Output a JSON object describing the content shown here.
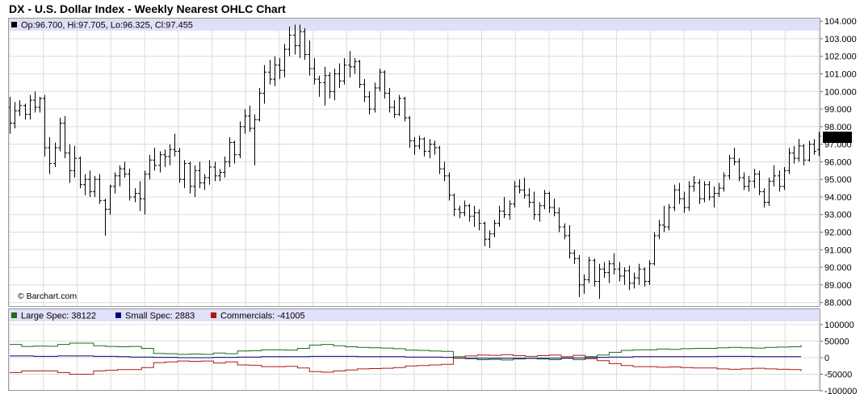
{
  "title": "DX - U.S. Dollar Index - Weekly Nearest OHLC Chart",
  "credit": "© Barchart.com",
  "colors": {
    "grid": "#dcdcdc",
    "legend_band": "#e0e0f8",
    "bar": "#000000",
    "large_spec": "#1a6b1a",
    "small_spec": "#000080",
    "commercials": "#b01818",
    "last_box_bg": "#000000",
    "last_box_fg": "#ffffff"
  },
  "chart_data": [
    {
      "type": "ohlc",
      "name": "price",
      "legend": {
        "open_label": "Op:",
        "open": "96.700",
        "high_label": "Hi:",
        "high": "97.705",
        "low_label": "Lo:",
        "low": "96.325",
        "close_label": "Cl:",
        "close": "97.455"
      },
      "last_value_label": "97.455",
      "ylim": [
        87.8,
        104.1
      ],
      "yticks": [
        "88.000",
        "89.000",
        "90.000",
        "91.000",
        "92.000",
        "93.000",
        "94.000",
        "95.000",
        "96.000",
        "97.000",
        "98.000",
        "99.000",
        "100.000",
        "101.000",
        "102.000",
        "103.000",
        "104.000"
      ],
      "bars": [
        [
          99.1,
          99.7,
          97.6,
          98.2
        ],
        [
          98.2,
          99.4,
          97.9,
          98.9
        ],
        [
          98.9,
          99.5,
          98.6,
          99.2
        ],
        [
          99.2,
          99.3,
          98.4,
          98.7
        ],
        [
          98.7,
          99.8,
          98.4,
          99.5
        ],
        [
          99.5,
          100.0,
          98.8,
          99.1
        ],
        [
          99.1,
          99.7,
          98.8,
          99.6
        ],
        [
          99.6,
          99.8,
          96.3,
          96.8
        ],
        [
          96.8,
          97.4,
          95.3,
          95.9
        ],
        [
          95.9,
          97.1,
          95.7,
          96.8
        ],
        [
          96.8,
          98.5,
          96.6,
          98.2
        ],
        [
          98.2,
          98.6,
          96.2,
          96.5
        ],
        [
          96.5,
          97.0,
          94.8,
          95.5
        ],
        [
          95.5,
          96.9,
          95.1,
          96.2
        ],
        [
          96.2,
          96.3,
          94.5,
          94.7
        ],
        [
          94.7,
          95.3,
          94.1,
          95.0
        ],
        [
          95.0,
          95.5,
          94.0,
          94.3
        ],
        [
          94.3,
          95.2,
          94.0,
          95.0
        ],
        [
          95.0,
          95.3,
          93.6,
          93.8
        ],
        [
          93.8,
          93.9,
          91.8,
          93.3
        ],
        [
          93.3,
          94.7,
          93.0,
          94.6
        ],
        [
          94.6,
          95.4,
          94.2,
          95.2
        ],
        [
          95.2,
          95.8,
          94.6,
          95.6
        ],
        [
          95.6,
          96.0,
          95.1,
          95.3
        ],
        [
          95.3,
          95.6,
          93.8,
          94.0
        ],
        [
          94.0,
          94.5,
          93.7,
          94.2
        ],
        [
          94.2,
          94.9,
          93.2,
          93.9
        ],
        [
          93.9,
          95.5,
          93.0,
          95.3
        ],
        [
          95.3,
          96.4,
          95.0,
          96.1
        ],
        [
          96.1,
          96.8,
          95.5,
          95.8
        ],
        [
          95.8,
          96.6,
          95.4,
          96.4
        ],
        [
          96.4,
          96.7,
          95.7,
          96.3
        ],
        [
          96.3,
          97.0,
          95.8,
          96.7
        ],
        [
          96.7,
          97.6,
          96.3,
          96.6
        ],
        [
          96.6,
          96.8,
          94.8,
          95.0
        ],
        [
          95.0,
          96.1,
          94.5,
          95.9
        ],
        [
          95.9,
          96.0,
          94.2,
          94.6
        ],
        [
          94.6,
          95.8,
          94.0,
          95.5
        ],
        [
          95.5,
          96.0,
          94.5,
          94.8
        ],
        [
          94.8,
          95.3,
          94.4,
          95.1
        ],
        [
          95.1,
          96.1,
          94.7,
          95.7
        ],
        [
          95.7,
          96.0,
          94.9,
          95.2
        ],
        [
          95.2,
          95.6,
          94.9,
          95.4
        ],
        [
          95.4,
          96.3,
          95.1,
          96.0
        ],
        [
          96.0,
          97.4,
          95.7,
          97.1
        ],
        [
          97.1,
          97.2,
          95.9,
          96.4
        ],
        [
          96.4,
          98.3,
          96.2,
          98.0
        ],
        [
          98.0,
          99.0,
          97.6,
          98.6
        ],
        [
          98.6,
          99.2,
          97.7,
          97.9
        ],
        [
          97.9,
          98.7,
          95.8,
          98.4
        ],
        [
          98.4,
          100.2,
          98.3,
          99.9
        ],
        [
          99.9,
          101.5,
          99.3,
          101.1
        ],
        [
          101.1,
          101.8,
          100.4,
          100.7
        ],
        [
          100.7,
          102.0,
          100.3,
          101.5
        ],
        [
          101.5,
          101.9,
          100.7,
          101.2
        ],
        [
          101.2,
          102.7,
          100.8,
          102.4
        ],
        [
          102.4,
          103.7,
          102.0,
          103.2
        ],
        [
          103.2,
          103.8,
          102.1,
          102.6
        ],
        [
          102.6,
          103.8,
          101.9,
          103.4
        ],
        [
          103.4,
          103.6,
          101.8,
          102.1
        ],
        [
          102.1,
          102.9,
          100.9,
          101.3
        ],
        [
          101.3,
          101.9,
          100.4,
          100.7
        ],
        [
          100.7,
          100.9,
          99.7,
          100.5
        ],
        [
          100.5,
          101.4,
          99.2,
          100.9
        ],
        [
          100.9,
          101.1,
          99.6,
          100.0
        ],
        [
          100.0,
          101.3,
          99.5,
          101.0
        ],
        [
          101.0,
          101.6,
          100.2,
          100.6
        ],
        [
          100.6,
          101.9,
          100.4,
          101.5
        ],
        [
          101.5,
          102.3,
          100.8,
          101.4
        ],
        [
          101.4,
          101.9,
          101.0,
          101.7
        ],
        [
          101.7,
          101.8,
          100.2,
          100.4
        ],
        [
          100.4,
          100.7,
          99.4,
          99.7
        ],
        [
          99.7,
          100.0,
          98.7,
          99.0
        ],
        [
          99.0,
          100.5,
          98.8,
          100.2
        ],
        [
          100.2,
          101.3,
          100.0,
          101.1
        ],
        [
          101.1,
          101.2,
          99.6,
          99.9
        ],
        [
          99.9,
          100.2,
          98.8,
          99.1
        ],
        [
          99.1,
          99.5,
          98.5,
          98.7
        ],
        [
          98.7,
          99.8,
          98.6,
          99.6
        ],
        [
          99.6,
          99.7,
          98.3,
          98.5
        ],
        [
          98.5,
          98.6,
          96.8,
          97.2
        ],
        [
          97.2,
          97.4,
          96.4,
          96.9
        ],
        [
          96.9,
          97.5,
          96.7,
          97.3
        ],
        [
          97.3,
          97.4,
          96.3,
          96.6
        ],
        [
          96.6,
          97.3,
          96.2,
          97.0
        ],
        [
          97.0,
          97.2,
          96.4,
          96.8
        ],
        [
          96.8,
          96.9,
          95.3,
          95.6
        ],
        [
          95.6,
          96.0,
          94.9,
          95.2
        ],
        [
          95.2,
          95.4,
          93.8,
          94.1
        ],
        [
          94.1,
          94.2,
          92.9,
          93.3
        ],
        [
          93.3,
          93.5,
          92.8,
          93.1
        ],
        [
          93.1,
          93.8,
          92.9,
          93.5
        ],
        [
          93.5,
          93.6,
          92.6,
          92.9
        ],
        [
          92.9,
          93.5,
          92.3,
          93.1
        ],
        [
          93.1,
          93.3,
          92.1,
          92.5
        ],
        [
          92.5,
          92.6,
          91.2,
          91.6
        ],
        [
          91.6,
          92.1,
          91.1,
          91.9
        ],
        [
          91.9,
          92.7,
          91.7,
          92.5
        ],
        [
          92.5,
          93.5,
          92.3,
          93.2
        ],
        [
          93.2,
          94.0,
          92.8,
          93.0
        ],
        [
          93.0,
          93.8,
          92.7,
          93.6
        ],
        [
          93.6,
          94.9,
          93.4,
          94.6
        ],
        [
          94.6,
          95.0,
          94.2,
          94.4
        ],
        [
          94.4,
          95.1,
          93.9,
          94.1
        ],
        [
          94.1,
          94.5,
          93.4,
          93.7
        ],
        [
          93.7,
          94.3,
          92.7,
          93.0
        ],
        [
          93.0,
          93.7,
          92.6,
          93.5
        ],
        [
          93.5,
          94.4,
          93.3,
          94.2
        ],
        [
          94.2,
          94.3,
          93.1,
          93.4
        ],
        [
          93.4,
          93.9,
          92.9,
          93.1
        ],
        [
          93.1,
          93.4,
          92.0,
          92.3
        ],
        [
          92.3,
          92.5,
          91.6,
          91.8
        ],
        [
          91.8,
          92.4,
          90.5,
          90.8
        ],
        [
          90.8,
          91.0,
          90.2,
          90.5
        ],
        [
          90.5,
          90.7,
          88.3,
          89.0
        ],
        [
          89.0,
          89.6,
          88.5,
          89.3
        ],
        [
          89.3,
          90.6,
          89.1,
          90.4
        ],
        [
          90.4,
          90.5,
          88.9,
          89.2
        ],
        [
          89.2,
          90.2,
          88.2,
          89.9
        ],
        [
          89.9,
          90.3,
          89.4,
          89.7
        ],
        [
          89.7,
          90.4,
          89.1,
          90.2
        ],
        [
          90.2,
          90.8,
          89.6,
          89.9
        ],
        [
          89.9,
          90.3,
          89.2,
          89.5
        ],
        [
          89.5,
          90.0,
          89.0,
          89.8
        ],
        [
          89.8,
          90.1,
          88.7,
          89.1
        ],
        [
          89.1,
          89.7,
          88.8,
          89.4
        ],
        [
          89.4,
          90.2,
          89.0,
          89.9
        ],
        [
          89.9,
          90.0,
          88.9,
          89.2
        ],
        [
          89.2,
          90.4,
          89.0,
          90.2
        ],
        [
          90.2,
          92.0,
          90.1,
          91.8
        ],
        [
          91.8,
          92.7,
          91.6,
          92.4
        ],
        [
          92.4,
          93.5,
          92.0,
          92.3
        ],
        [
          92.3,
          93.6,
          92.1,
          93.4
        ],
        [
          93.4,
          94.7,
          93.2,
          94.4
        ],
        [
          94.4,
          94.8,
          93.6,
          93.9
        ],
        [
          93.9,
          94.3,
          93.1,
          93.4
        ],
        [
          93.4,
          94.9,
          93.2,
          94.6
        ],
        [
          94.6,
          95.2,
          94.3,
          94.8
        ],
        [
          94.8,
          95.0,
          93.6,
          93.9
        ],
        [
          93.9,
          94.9,
          93.7,
          94.7
        ],
        [
          94.7,
          94.9,
          93.8,
          94.0
        ],
        [
          94.0,
          94.6,
          93.4,
          94.2
        ],
        [
          94.2,
          94.8,
          94.0,
          94.5
        ],
        [
          94.5,
          95.4,
          94.3,
          95.2
        ],
        [
          95.2,
          96.4,
          95.0,
          96.2
        ],
        [
          96.2,
          96.8,
          95.8,
          96.0
        ],
        [
          96.0,
          96.2,
          94.9,
          95.1
        ],
        [
          95.1,
          95.4,
          94.4,
          94.6
        ],
        [
          94.6,
          95.2,
          94.3,
          94.9
        ],
        [
          94.9,
          95.6,
          94.5,
          95.3
        ],
        [
          95.3,
          95.5,
          94.1,
          94.3
        ],
        [
          94.3,
          94.5,
          93.4,
          93.7
        ],
        [
          93.7,
          95.1,
          93.5,
          94.9
        ],
        [
          94.9,
          95.8,
          94.6,
          95.2
        ],
        [
          95.2,
          95.5,
          94.3,
          94.6
        ],
        [
          94.6,
          95.7,
          94.4,
          95.5
        ],
        [
          95.5,
          96.8,
          95.3,
          96.5
        ],
        [
          96.5,
          96.9,
          95.9,
          96.2
        ],
        [
          96.2,
          97.3,
          96.0,
          96.9
        ],
        [
          96.9,
          97.0,
          95.8,
          96.1
        ],
        [
          96.1,
          97.2,
          96.0,
          97.0
        ],
        [
          97.0,
          97.3,
          96.4,
          96.6
        ],
        [
          96.7,
          97.705,
          96.325,
          97.455
        ]
      ]
    },
    {
      "type": "line",
      "name": "cot",
      "ylim": [
        -100000,
        100000
      ],
      "yticks": [
        "100000",
        "50000",
        "0",
        "-50000",
        "-100000"
      ],
      "series": [
        {
          "name": "Large Spec",
          "last_value": "38122",
          "color": "#1a6b1a",
          "values": [
            40000,
            34000,
            35000,
            34500,
            40000,
            44000,
            44000,
            36000,
            34000,
            33000,
            34000,
            28000,
            13000,
            12000,
            10000,
            11000,
            10000,
            14000,
            12000,
            20000,
            21000,
            24000,
            24000,
            23000,
            28000,
            38000,
            40000,
            36000,
            33000,
            31000,
            30000,
            29000,
            27000,
            23000,
            22000,
            20000,
            19000,
            3000,
            -3000,
            -6000,
            -5000,
            -7000,
            -4000,
            -2000,
            -4000,
            -6000,
            -2000,
            -6000,
            3000,
            8000,
            16000,
            22000,
            24000,
            24000,
            26000,
            25000,
            27000,
            28000,
            28000,
            30000,
            31000,
            30000,
            29000,
            31000,
            32000,
            33000,
            38122
          ]
        },
        {
          "name": "Small Spec",
          "last_value": "2883",
          "color": "#000080",
          "values": [
            5000,
            5000,
            4000,
            4000,
            5000,
            5000,
            5000,
            4000,
            4000,
            3000,
            2000,
            2000,
            1000,
            1000,
            0,
            0,
            0,
            1000,
            1000,
            2000,
            2000,
            3000,
            3000,
            3000,
            3000,
            4000,
            4000,
            4000,
            4000,
            3000,
            3000,
            3000,
            3000,
            2000,
            2000,
            2000,
            1000,
            -1000,
            -2000,
            -2000,
            -2000,
            -2000,
            -2000,
            -2000,
            -2000,
            -2000,
            -1000,
            -1000,
            0,
            1000,
            2000,
            2000,
            3000,
            3000,
            3000,
            3000,
            3000,
            3000,
            3000,
            4000,
            4000,
            4000,
            3000,
            3000,
            3000,
            3000,
            2883
          ]
        },
        {
          "name": "Commercials",
          "last_value": "-41005",
          "color": "#b01818",
          "values": [
            -45000,
            -40000,
            -40000,
            -40000,
            -45000,
            -50000,
            -50000,
            -40000,
            -38000,
            -36000,
            -36000,
            -30000,
            -15000,
            -13000,
            -10000,
            -11000,
            -10000,
            -16000,
            -13000,
            -22000,
            -23000,
            -27000,
            -27000,
            -26000,
            -31000,
            -42000,
            -44000,
            -40000,
            -37000,
            -34000,
            -33000,
            -32000,
            -30000,
            -25000,
            -24000,
            -22000,
            -20000,
            -2000,
            5000,
            8000,
            7000,
            9000,
            6000,
            4000,
            6000,
            8000,
            3000,
            7000,
            -3000,
            -9000,
            -18000,
            -24000,
            -27000,
            -27000,
            -29000,
            -28000,
            -30000,
            -31000,
            -31000,
            -34000,
            -35000,
            -34000,
            -32000,
            -34000,
            -35000,
            -36000,
            -41005
          ]
        }
      ]
    }
  ]
}
